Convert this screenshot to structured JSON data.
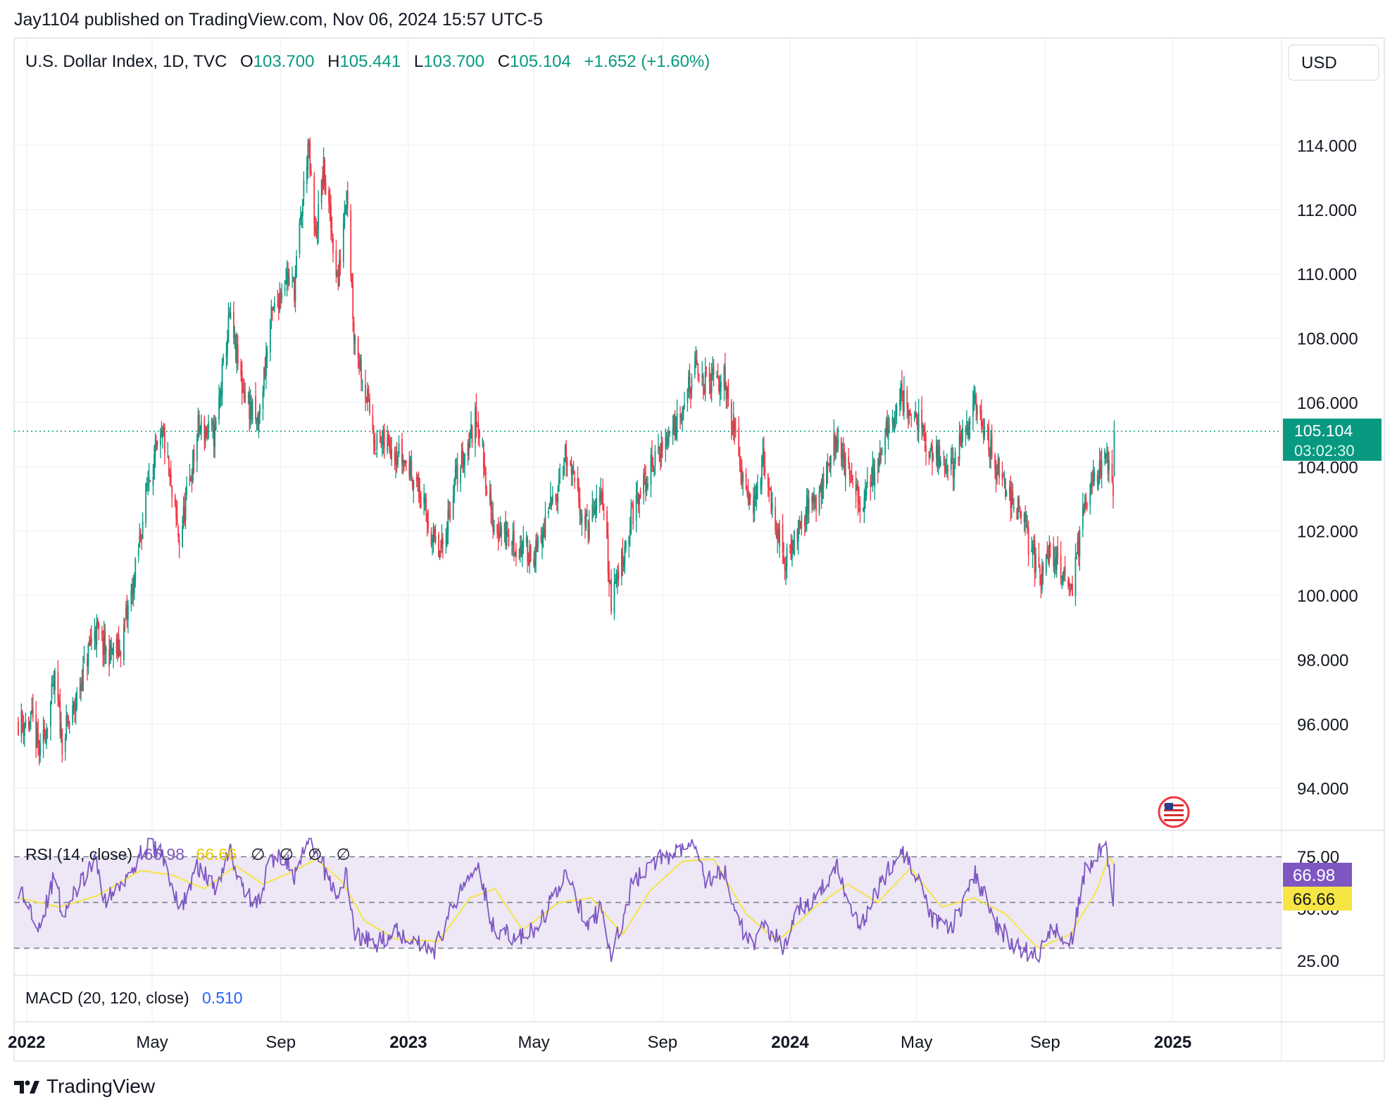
{
  "header": {
    "publisher_line": "Jay1104 published on TradingView.com, Nov 06, 2024 15:57 UTC-5"
  },
  "legend": {
    "symbol": "U.S. Dollar Index, 1D, TVC",
    "open_label": "O",
    "open_value": "103.700",
    "high_label": "H",
    "high_value": "105.441",
    "low_label": "L",
    "low_value": "103.700",
    "close_label": "C",
    "close_value": "105.104",
    "change": "+1.652 (+1.60%)"
  },
  "currency_button": "USD",
  "price_badge": {
    "price": "105.104",
    "countdown": "03:02:30"
  },
  "rsi": {
    "label": "RSI (14, close)",
    "value": "66.98",
    "ma_value": "66.66",
    "empty_marks": [
      "∅",
      "∅",
      "∅",
      "∅"
    ],
    "axis_top": "75.00",
    "axis_mid": "50.00",
    "axis_bottom": "25.00",
    "badge_value": "66.98",
    "badge_ma": "66.66"
  },
  "macd": {
    "label": "MACD (20, 120, close)",
    "value": "0.510"
  },
  "footer": {
    "brand": "TradingView"
  },
  "colors": {
    "up": "#089981",
    "down": "#f23645",
    "rsi_line": "#7e57c2",
    "rsi_ma": "#f6e543",
    "rsi_band": "#ede7f6",
    "macd_value": "#2962ff",
    "badge_bg": "#089981"
  },
  "chart_data": {
    "type": "candlestick",
    "symbol": "U.S. Dollar Index",
    "interval": "1D",
    "y_ticks": [
      "94.000",
      "96.000",
      "98.000",
      "100.000",
      "102.000",
      "104.000",
      "106.000",
      "108.000",
      "110.000",
      "112.000",
      "114.000"
    ],
    "x_ticks": [
      {
        "label": "2022",
        "bold": true,
        "date": "2022-01-01"
      },
      {
        "label": "May",
        "bold": false,
        "date": "2022-05-01"
      },
      {
        "label": "Sep",
        "bold": false,
        "date": "2022-09-01"
      },
      {
        "label": "2023",
        "bold": true,
        "date": "2023-01-01"
      },
      {
        "label": "May",
        "bold": false,
        "date": "2023-05-01"
      },
      {
        "label": "Sep",
        "bold": false,
        "date": "2023-09-01"
      },
      {
        "label": "2024",
        "bold": true,
        "date": "2024-01-01"
      },
      {
        "label": "May",
        "bold": false,
        "date": "2024-05-01"
      },
      {
        "label": "Sep",
        "bold": false,
        "date": "2024-09-01"
      },
      {
        "label": "2025",
        "bold": true,
        "date": "2025-01-01"
      }
    ],
    "ylim": [
      92.8,
      116.0
    ],
    "last_price": 105.104,
    "price_path": [
      [
        "2021-12-24",
        96.1
      ],
      [
        "2022-01-07",
        96.0
      ],
      [
        "2022-01-14",
        95.0
      ],
      [
        "2022-01-28",
        97.3
      ],
      [
        "2022-02-04",
        95.5
      ],
      [
        "2022-02-14",
        96.3
      ],
      [
        "2022-03-07",
        99.0
      ],
      [
        "2022-03-18",
        98.2
      ],
      [
        "2022-03-31",
        98.3
      ],
      [
        "2022-04-14",
        100.5
      ],
      [
        "2022-04-28",
        103.8
      ],
      [
        "2022-05-12",
        104.9
      ],
      [
        "2022-05-20",
        103.0
      ],
      [
        "2022-05-27",
        101.7
      ],
      [
        "2022-06-10",
        104.3
      ],
      [
        "2022-06-14",
        105.2
      ],
      [
        "2022-06-30",
        105.0
      ],
      [
        "2022-07-14",
        108.6
      ],
      [
        "2022-07-26",
        106.5
      ],
      [
        "2022-08-10",
        105.2
      ],
      [
        "2022-08-22",
        108.5
      ],
      [
        "2022-09-06",
        110.0
      ],
      [
        "2022-09-14",
        109.6
      ],
      [
        "2022-09-27",
        114.0
      ],
      [
        "2022-10-04",
        111.1
      ],
      [
        "2022-10-12",
        113.2
      ],
      [
        "2022-10-26",
        109.7
      ],
      [
        "2022-11-03",
        112.9
      ],
      [
        "2022-11-10",
        108.2
      ],
      [
        "2022-11-18",
        106.9
      ],
      [
        "2022-12-01",
        104.7
      ],
      [
        "2022-12-16",
        104.7
      ],
      [
        "2023-01-06",
        103.8
      ],
      [
        "2023-01-26",
        101.6
      ],
      [
        "2023-02-01",
        101.2
      ],
      [
        "2023-02-14",
        103.5
      ],
      [
        "2023-03-08",
        105.6
      ],
      [
        "2023-03-22",
        102.3
      ],
      [
        "2023-04-14",
        101.5
      ],
      [
        "2023-05-04",
        101.3
      ],
      [
        "2023-05-31",
        104.3
      ],
      [
        "2023-06-21",
        102.1
      ],
      [
        "2023-07-06",
        103.1
      ],
      [
        "2023-07-14",
        99.8
      ],
      [
        "2023-08-03",
        102.5
      ],
      [
        "2023-08-24",
        104.2
      ],
      [
        "2023-09-08",
        105.0
      ],
      [
        "2023-10-03",
        107.0
      ],
      [
        "2023-10-12",
        106.6
      ],
      [
        "2023-10-31",
        106.7
      ],
      [
        "2023-11-14",
        104.1
      ],
      [
        "2023-11-28",
        102.8
      ],
      [
        "2023-12-06",
        104.1
      ],
      [
        "2023-12-27",
        100.9
      ],
      [
        "2024-01-11",
        102.4
      ],
      [
        "2024-01-31",
        103.3
      ],
      [
        "2024-02-14",
        104.9
      ],
      [
        "2024-03-08",
        102.7
      ],
      [
        "2024-03-28",
        104.5
      ],
      [
        "2024-04-16",
        106.3
      ],
      [
        "2024-05-06",
        105.1
      ],
      [
        "2024-05-15",
        104.3
      ],
      [
        "2024-06-04",
        104.0
      ],
      [
        "2024-06-26",
        106.0
      ],
      [
        "2024-07-17",
        103.9
      ],
      [
        "2024-08-05",
        102.8
      ],
      [
        "2024-08-26",
        100.7
      ],
      [
        "2024-09-05",
        101.2
      ],
      [
        "2024-09-27",
        100.4
      ],
      [
        "2024-10-10",
        102.9
      ],
      [
        "2024-10-29",
        104.3
      ],
      [
        "2024-11-05",
        103.5
      ],
      [
        "2024-11-06",
        105.1
      ]
    ],
    "rsi_ylim": [
      20,
      80
    ],
    "rsi_path": [
      [
        "2021-12-24",
        56
      ],
      [
        "2022-01-14",
        40
      ],
      [
        "2022-01-28",
        62
      ],
      [
        "2022-02-04",
        45
      ],
      [
        "2022-03-07",
        68
      ],
      [
        "2022-03-18",
        50
      ],
      [
        "2022-04-14",
        67
      ],
      [
        "2022-04-28",
        76
      ],
      [
        "2022-05-12",
        70
      ],
      [
        "2022-05-27",
        46
      ],
      [
        "2022-06-14",
        66
      ],
      [
        "2022-06-30",
        56
      ],
      [
        "2022-07-14",
        74
      ],
      [
        "2022-07-26",
        56
      ],
      [
        "2022-08-10",
        49
      ],
      [
        "2022-08-22",
        69
      ],
      [
        "2022-09-06",
        70
      ],
      [
        "2022-09-14",
        60
      ],
      [
        "2022-09-27",
        77
      ],
      [
        "2022-10-12",
        65
      ],
      [
        "2022-10-26",
        52
      ],
      [
        "2022-11-03",
        63
      ],
      [
        "2022-11-10",
        37
      ],
      [
        "2022-11-18",
        35
      ],
      [
        "2022-12-01",
        31
      ],
      [
        "2022-12-16",
        38
      ],
      [
        "2023-01-06",
        34
      ],
      [
        "2023-01-26",
        29
      ],
      [
        "2023-02-14",
        50
      ],
      [
        "2023-03-08",
        69
      ],
      [
        "2023-03-22",
        40
      ],
      [
        "2023-04-14",
        34
      ],
      [
        "2023-05-04",
        38
      ],
      [
        "2023-05-31",
        63
      ],
      [
        "2023-06-21",
        40
      ],
      [
        "2023-07-06",
        48
      ],
      [
        "2023-07-14",
        25
      ],
      [
        "2023-08-03",
        58
      ],
      [
        "2023-08-24",
        68
      ],
      [
        "2023-09-08",
        71
      ],
      [
        "2023-10-03",
        78
      ],
      [
        "2023-10-12",
        60
      ],
      [
        "2023-10-31",
        63
      ],
      [
        "2023-11-14",
        40
      ],
      [
        "2023-11-28",
        29
      ],
      [
        "2023-12-06",
        42
      ],
      [
        "2023-12-27",
        30
      ],
      [
        "2024-01-11",
        48
      ],
      [
        "2024-01-31",
        55
      ],
      [
        "2024-02-14",
        66
      ],
      [
        "2024-03-08",
        40
      ],
      [
        "2024-03-28",
        58
      ],
      [
        "2024-04-16",
        74
      ],
      [
        "2024-05-06",
        55
      ],
      [
        "2024-05-15",
        42
      ],
      [
        "2024-06-04",
        40
      ],
      [
        "2024-06-26",
        62
      ],
      [
        "2024-07-17",
        40
      ],
      [
        "2024-08-05",
        30
      ],
      [
        "2024-08-26",
        26
      ],
      [
        "2024-09-05",
        38
      ],
      [
        "2024-09-27",
        35
      ],
      [
        "2024-10-10",
        66
      ],
      [
        "2024-10-29",
        74
      ],
      [
        "2024-11-05",
        52
      ],
      [
        "2024-11-06",
        66.98
      ]
    ],
    "rsi_ma_path": [
      [
        "2021-12-24",
        52
      ],
      [
        "2022-02-01",
        48
      ],
      [
        "2022-03-10",
        53
      ],
      [
        "2022-04-20",
        64
      ],
      [
        "2022-05-20",
        62
      ],
      [
        "2022-06-20",
        56
      ],
      [
        "2022-07-20",
        66
      ],
      [
        "2022-08-15",
        58
      ],
      [
        "2022-09-10",
        63
      ],
      [
        "2022-10-05",
        69
      ],
      [
        "2022-10-30",
        59
      ],
      [
        "2022-11-20",
        42
      ],
      [
        "2022-12-20",
        34
      ],
      [
        "2023-01-30",
        33
      ],
      [
        "2023-03-01",
        52
      ],
      [
        "2023-03-25",
        56
      ],
      [
        "2023-04-20",
        38
      ],
      [
        "2023-05-25",
        50
      ],
      [
        "2023-06-25",
        52
      ],
      [
        "2023-07-25",
        36
      ],
      [
        "2023-08-20",
        55
      ],
      [
        "2023-09-20",
        68
      ],
      [
        "2023-10-20",
        69
      ],
      [
        "2023-11-20",
        45
      ],
      [
        "2023-12-20",
        33
      ],
      [
        "2024-01-25",
        48
      ],
      [
        "2024-02-25",
        58
      ],
      [
        "2024-03-25",
        50
      ],
      [
        "2024-04-25",
        65
      ],
      [
        "2024-05-25",
        48
      ],
      [
        "2024-06-25",
        52
      ],
      [
        "2024-07-25",
        45
      ],
      [
        "2024-08-25",
        30
      ],
      [
        "2024-09-25",
        36
      ],
      [
        "2024-10-20",
        55
      ],
      [
        "2024-11-01",
        70
      ],
      [
        "2024-11-06",
        66.66
      ]
    ]
  }
}
